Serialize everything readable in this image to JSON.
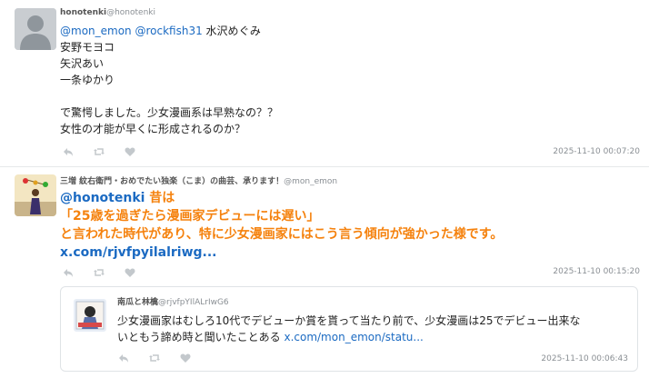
{
  "colors": {
    "link": "#1b6ac2",
    "orange": "#f5820e",
    "meta": "#8a8f94"
  },
  "tweets": [
    {
      "author_name": "honotenki",
      "author_handle": "@honotenki",
      "mention1": "@mon_emon",
      "mention2": "@rockfish31",
      "line1_rest": " 水沢めぐみ",
      "lines": [
        "安野モヨコ",
        "矢沢あい",
        "一条ゆかり",
        "",
        "で驚愕しました。少女漫画系は早熟なの？？",
        "女性の才能が早くに形成されるのか？"
      ],
      "timestamp": "2025-11-10 00:07:20"
    },
    {
      "author_name": "三増 紋右衛門・おめでたい独楽（こま）の曲芸、承ります！",
      "author_handle": "@mon_emon",
      "mention": "@honotenki",
      "line1_rest": " 昔は",
      "lines": [
        "「25歳を過ぎたら漫画家デビューには遅い」",
        "と言われた時代があり、特に少女漫画家にはこう言う傾向が強かった様です。"
      ],
      "link": "x.com/rjvfpyilalriwg...",
      "timestamp": "2025-11-10 00:15:20"
    }
  ],
  "quote": {
    "author_name": "南瓜と林檎",
    "author_handle": "@rjvfpYIlALrIwG6",
    "line1": "少女漫画家はむしろ10代でデビューか賞を貰って当たり前で、少女漫画は25でデビュー出来な",
    "line2": "いともう諦め時と聞いたことある ",
    "link": "x.com/mon_emon/statu...",
    "timestamp": "2025-11-10 00:06:43"
  },
  "icons": [
    "reply-icon",
    "retweet-icon",
    "like-icon"
  ]
}
